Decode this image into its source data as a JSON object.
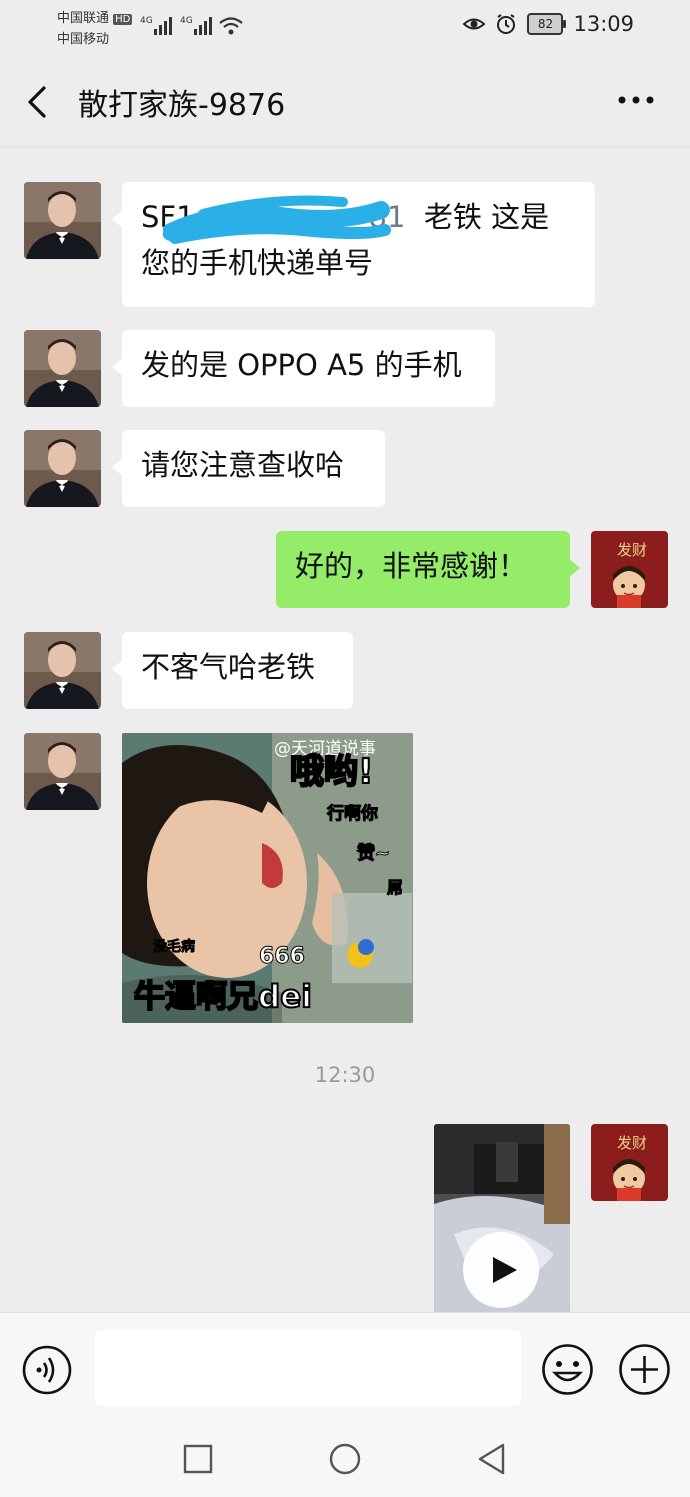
{
  "status_bar": {
    "carrier1": "中国联通",
    "hd": "HD",
    "carrier2": "中国移动",
    "net1": "4G",
    "net2": "4G",
    "battery": "82",
    "time": "13:09"
  },
  "header": {
    "title": "散打家族-9876"
  },
  "messages": [
    {
      "side": "in",
      "type": "text",
      "line1_visible_start": "SF1",
      "line1_visible_end": "81",
      "line1_suffix": "老铁 这是",
      "line2": "您的手机快递单号"
    },
    {
      "side": "in",
      "type": "text",
      "text": "发的是 OPPO A5 的手机"
    },
    {
      "side": "in",
      "type": "text",
      "text": "请您注意查收哈"
    },
    {
      "side": "out",
      "type": "text",
      "text": "好的，非常感谢！"
    },
    {
      "side": "in",
      "type": "text",
      "text": "不客气哈老铁"
    },
    {
      "side": "in",
      "type": "sticker",
      "watermark": "@天河道说事",
      "captions": [
        "哦哟!",
        "行啊你",
        "赞~",
        "屌",
        "没毛病",
        "666",
        "牛逼啊兄dei"
      ]
    },
    {
      "side": "out",
      "type": "video"
    }
  ],
  "timestamp": "12:30",
  "avatar_right_text": "发财",
  "colors": {
    "background": "#ededed",
    "incoming_bubble": "#ffffff",
    "outgoing_bubble": "#95ec69",
    "redact_scribble": "#2ab0e6"
  },
  "icons": [
    "back-icon",
    "more-icon",
    "voice-icon",
    "emoji-icon",
    "plus-icon",
    "square-nav-icon",
    "circle-nav-icon",
    "triangle-nav-icon"
  ]
}
